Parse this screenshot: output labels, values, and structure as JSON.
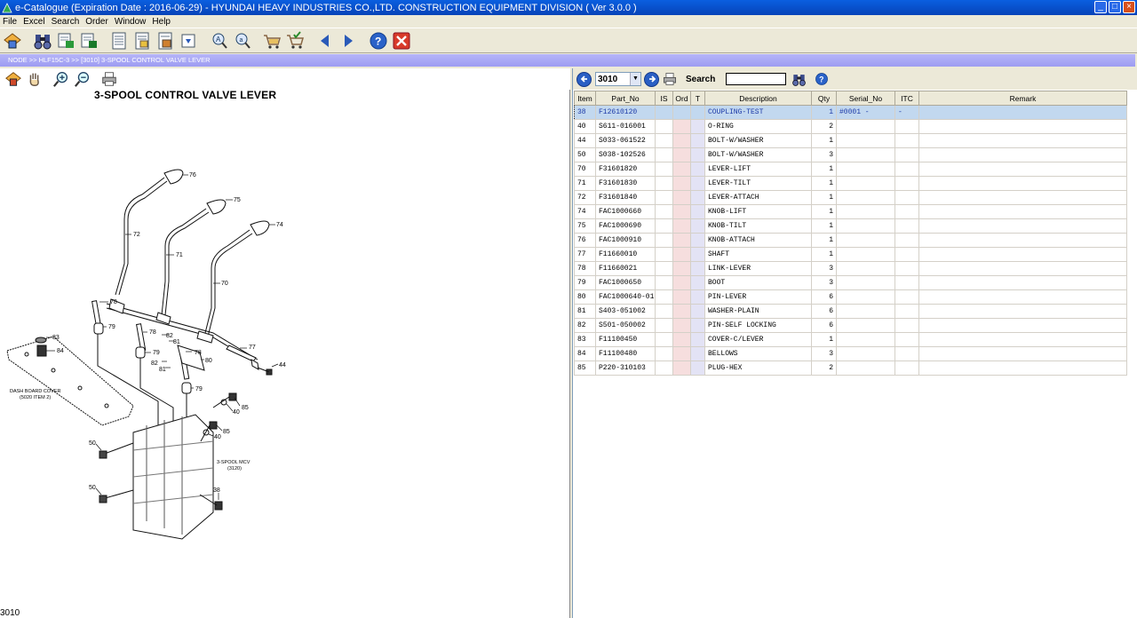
{
  "window": {
    "title": "e-Catalogue (Expiration Date : 2016-06-29)  -  HYUNDAI HEAVY INDUSTRIES CO.,LTD. CONSTRUCTION EQUIPMENT DIVISION ( Ver 3.0.0 )",
    "minimize": "_",
    "maximize": "□",
    "close": "×"
  },
  "menu": [
    "File",
    "Excel",
    "Search",
    "Order",
    "Window",
    "Help"
  ],
  "breadcrumb": "NODE >> HLF15C-3 >> [3010] 3-SPOOL CONTROL VALVE LEVER",
  "diagram": {
    "title": "3-SPOOL CONTROL VALVE LEVER",
    "page_code": "3010",
    "callouts": [
      "76",
      "75",
      "74",
      "72",
      "71",
      "70",
      "78",
      "79",
      "78",
      "82",
      "81",
      "78",
      "80",
      "77",
      "44",
      "83",
      "84",
      "79",
      "82",
      "81",
      "79",
      "85",
      "40",
      "85",
      "40",
      "50",
      "50",
      "38"
    ],
    "dash_label_1": "DASH BOARD COVER",
    "dash_label_2": "(5020 ITEM 2)",
    "mcv_label_1": "3-SPOOL MCV",
    "mcv_label_2": "(3120)"
  },
  "parts_toolbar": {
    "page_value": "3010",
    "search_label": "Search",
    "search_value": ""
  },
  "table": {
    "headers": [
      "Item",
      "Part_No",
      "IS",
      "Ord",
      "T",
      "Description",
      "Qty",
      "Serial_No",
      "ITC",
      "Remark"
    ],
    "rows": [
      {
        "item": "38",
        "part_no": "F12610120",
        "is": "",
        "ord": "",
        "t": "",
        "desc": "COUPLING-TEST",
        "qty": "1",
        "serial": "#0001 -",
        "itc": "-",
        "remark": ""
      },
      {
        "item": "40",
        "part_no": "S611-016001",
        "is": "",
        "ord": "",
        "t": "",
        "desc": "O-RING",
        "qty": "2",
        "serial": "",
        "itc": "",
        "remark": ""
      },
      {
        "item": "44",
        "part_no": "S033-061522",
        "is": "",
        "ord": "",
        "t": "",
        "desc": "BOLT-W/WASHER",
        "qty": "1",
        "serial": "",
        "itc": "",
        "remark": ""
      },
      {
        "item": "50",
        "part_no": "S038-102526",
        "is": "",
        "ord": "",
        "t": "",
        "desc": "BOLT-W/WASHER",
        "qty": "3",
        "serial": "",
        "itc": "",
        "remark": ""
      },
      {
        "item": "70",
        "part_no": "F31601820",
        "is": "",
        "ord": "",
        "t": "",
        "desc": "LEVER-LIFT",
        "qty": "1",
        "serial": "",
        "itc": "",
        "remark": ""
      },
      {
        "item": "71",
        "part_no": "F31601830",
        "is": "",
        "ord": "",
        "t": "",
        "desc": "LEVER-TILT",
        "qty": "1",
        "serial": "",
        "itc": "",
        "remark": ""
      },
      {
        "item": "72",
        "part_no": "F31601840",
        "is": "",
        "ord": "",
        "t": "",
        "desc": "LEVER-ATTACH",
        "qty": "1",
        "serial": "",
        "itc": "",
        "remark": ""
      },
      {
        "item": "74",
        "part_no": "FAC1000660",
        "is": "",
        "ord": "",
        "t": "",
        "desc": "KNOB-LIFT",
        "qty": "1",
        "serial": "",
        "itc": "",
        "remark": ""
      },
      {
        "item": "75",
        "part_no": "FAC1000690",
        "is": "",
        "ord": "",
        "t": "",
        "desc": "KNOB-TILT",
        "qty": "1",
        "serial": "",
        "itc": "",
        "remark": ""
      },
      {
        "item": "76",
        "part_no": "FAC1000910",
        "is": "",
        "ord": "",
        "t": "",
        "desc": "KNOB-ATTACH",
        "qty": "1",
        "serial": "",
        "itc": "",
        "remark": ""
      },
      {
        "item": "77",
        "part_no": "F11660010",
        "is": "",
        "ord": "",
        "t": "",
        "desc": "SHAFT",
        "qty": "1",
        "serial": "",
        "itc": "",
        "remark": ""
      },
      {
        "item": "78",
        "part_no": "F11660021",
        "is": "",
        "ord": "",
        "t": "",
        "desc": "LINK-LEVER",
        "qty": "3",
        "serial": "",
        "itc": "",
        "remark": ""
      },
      {
        "item": "79",
        "part_no": "FAC1000650",
        "is": "",
        "ord": "",
        "t": "",
        "desc": "BOOT",
        "qty": "3",
        "serial": "",
        "itc": "",
        "remark": ""
      },
      {
        "item": "80",
        "part_no": "FAC1000640-01",
        "is": "",
        "ord": "",
        "t": "",
        "desc": "PIN-LEVER",
        "qty": "6",
        "serial": "",
        "itc": "",
        "remark": ""
      },
      {
        "item": "81",
        "part_no": "S403-051002",
        "is": "",
        "ord": "",
        "t": "",
        "desc": "WASHER-PLAIN",
        "qty": "6",
        "serial": "",
        "itc": "",
        "remark": ""
      },
      {
        "item": "82",
        "part_no": "S501-050002",
        "is": "",
        "ord": "",
        "t": "",
        "desc": "PIN-SELF LOCKING",
        "qty": "6",
        "serial": "",
        "itc": "",
        "remark": ""
      },
      {
        "item": "83",
        "part_no": "F11100450",
        "is": "",
        "ord": "",
        "t": "",
        "desc": "COVER-C/LEVER",
        "qty": "1",
        "serial": "",
        "itc": "",
        "remark": ""
      },
      {
        "item": "84",
        "part_no": "F11100480",
        "is": "",
        "ord": "",
        "t": "",
        "desc": "BELLOWS",
        "qty": "3",
        "serial": "",
        "itc": "",
        "remark": ""
      },
      {
        "item": "85",
        "part_no": "P220-310103",
        "is": "",
        "ord": "",
        "t": "",
        "desc": "PLUG-HEX",
        "qty": "2",
        "serial": "",
        "itc": "",
        "remark": ""
      }
    ]
  }
}
